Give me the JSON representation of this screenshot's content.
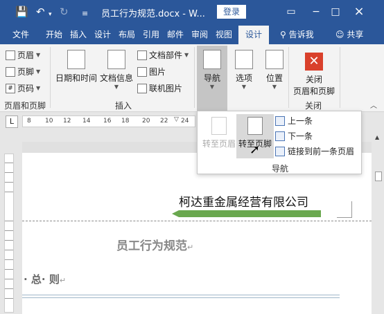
{
  "title_bar": {
    "doc_title": "员工行为规范.docx - W...",
    "login_label": "登录",
    "minimize": "−",
    "maximize": "□",
    "close": "×"
  },
  "tabs": [
    {
      "label": "文件"
    },
    {
      "label": "开始"
    },
    {
      "label": "插入"
    },
    {
      "label": "设计"
    },
    {
      "label": "布局"
    },
    {
      "label": "引用"
    },
    {
      "label": "邮件"
    },
    {
      "label": "审阅"
    },
    {
      "label": "视图"
    },
    {
      "label": "设计",
      "active": true
    }
  ],
  "tell_me": "告诉我",
  "share": "共享",
  "ribbon": {
    "header_footer": {
      "items": [
        "页眉",
        "页脚",
        "页码"
      ],
      "group_label": "页眉和页脚"
    },
    "insert": {
      "date_time": "日期和时间",
      "doc_info": "文档信息",
      "doc_parts": "文档部件",
      "picture": "图片",
      "online_picture": "联机图片",
      "group_label": "插入"
    },
    "navigation": {
      "label": "导航"
    },
    "options": {
      "label": "选项"
    },
    "position": {
      "label": "位置"
    },
    "close": {
      "label_line1": "关闭",
      "label_line2": "页眉和页脚",
      "group_label": "关闭",
      "accent": "#d9402b"
    }
  },
  "ruler": {
    "corner": "L",
    "ticks": [
      "8",
      "10",
      "12",
      "14",
      "16",
      "18",
      "20",
      "22",
      "24"
    ]
  },
  "dropdown": {
    "goto_header": "转至页眉",
    "goto_footer": "转至页脚",
    "previous": "上一条",
    "next": "下一条",
    "link_previous": "链接到前一条页眉",
    "group_label": "导航"
  },
  "document": {
    "header_text": "柯达重金属经营有限公司",
    "title": "员工行为规范",
    "paragraph_mark": "↵",
    "section_heading": "· 总· 则",
    "arrow_color": "#6aa84f"
  },
  "colors": {
    "brand": "#2b579a",
    "ribbon_bg": "#f3f3f3"
  }
}
